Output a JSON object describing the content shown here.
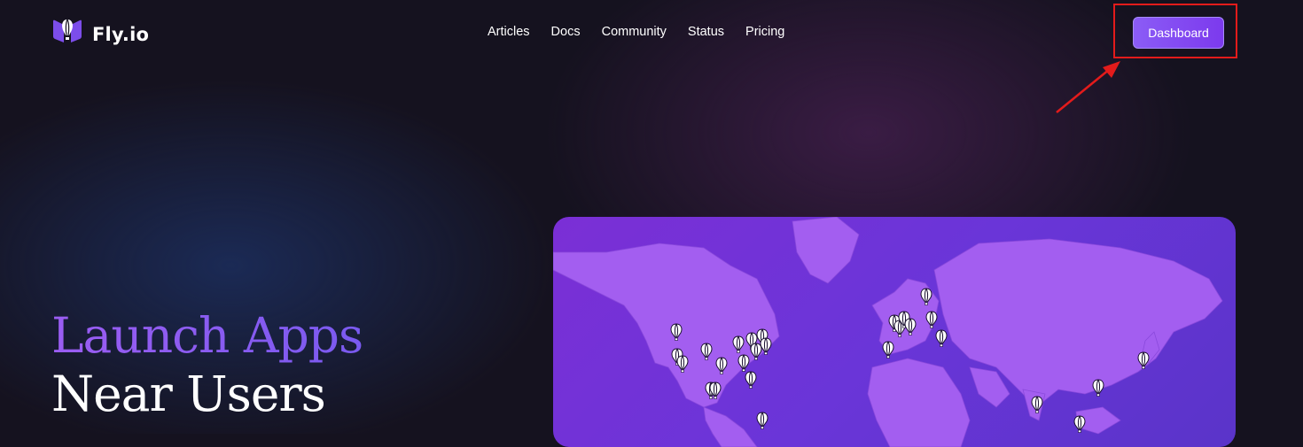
{
  "header": {
    "brand": "Fly.io",
    "nav": [
      "Articles",
      "Docs",
      "Community",
      "Status",
      "Pricing"
    ],
    "dashboard_label": "Dashboard"
  },
  "hero": {
    "line1": "Launch Apps",
    "line2": "Near Users"
  },
  "icons": {
    "logo": "fly-balloon-logo-icon",
    "pin": "balloon-pin-icon"
  },
  "colors": {
    "accent": "#8b5cf6",
    "annotation": "#e31b1b",
    "map_land": "#a35ef0"
  }
}
